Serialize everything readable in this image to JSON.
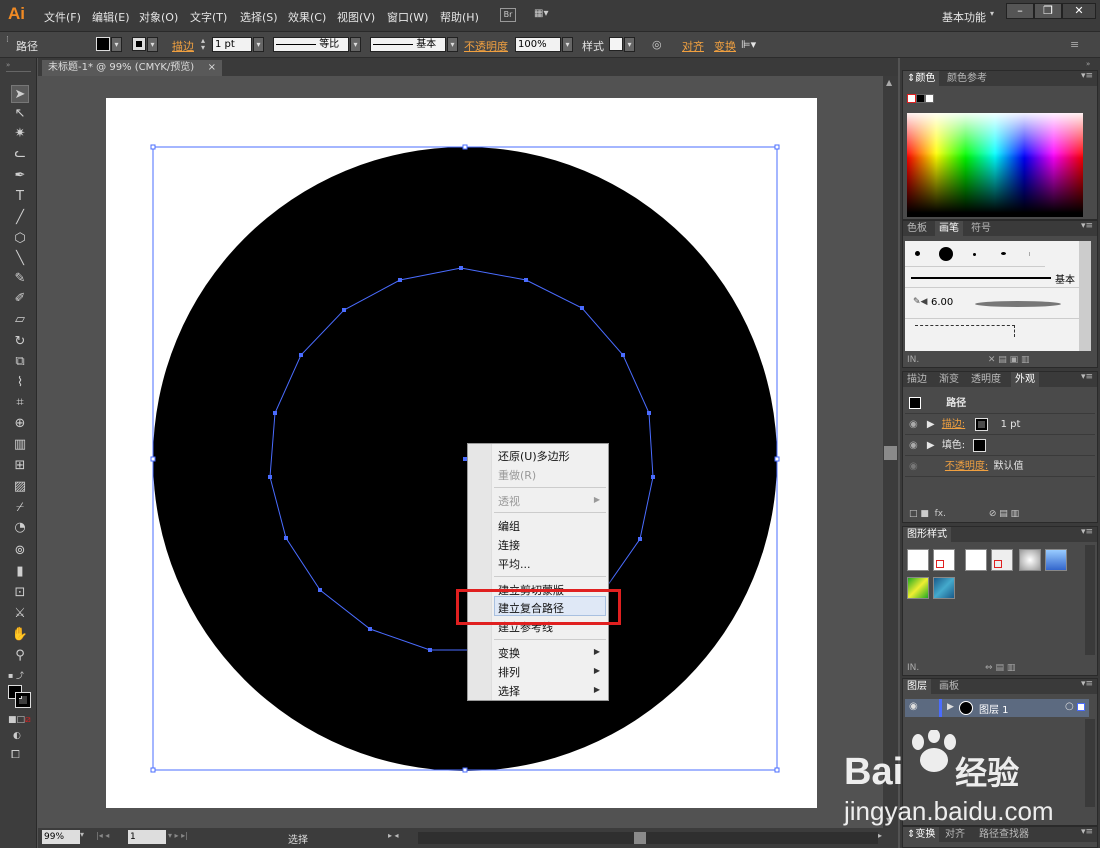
{
  "app": {
    "logo": "Ai",
    "workspace": "基本功能"
  },
  "menu": [
    "文件(F)",
    "编辑(E)",
    "对象(O)",
    "文字(T)",
    "选择(S)",
    "效果(C)",
    "视图(V)",
    "窗口(W)",
    "帮助(H)"
  ],
  "menu_extra": {
    "br": "Br"
  },
  "window_buttons": {
    "minimize": "–",
    "restore": "❐",
    "close": "✕"
  },
  "control": {
    "object_type": "路径",
    "stroke_label": "描边",
    "stroke_weight": "1 pt",
    "profile": "等比",
    "brush": "基本",
    "opacity_label": "不透明度",
    "opacity": "100%",
    "style_label": "样式",
    "align": "对齐",
    "transform": "变换"
  },
  "document": {
    "tab_title": "未标题-1* @ 99% (CMYK/预览)",
    "tab_close": "×"
  },
  "status": {
    "zoom": "99%",
    "page": "1",
    "mode": "选择"
  },
  "context_menu": {
    "items": [
      {
        "label": "还原(U)多边形",
        "enabled": true,
        "submenu": false
      },
      {
        "label": "重做(R)",
        "enabled": false,
        "submenu": false
      },
      {
        "label": "透视",
        "enabled": false,
        "submenu": true
      },
      {
        "label": "编组",
        "enabled": true,
        "submenu": false
      },
      {
        "label": "连接",
        "enabled": true,
        "submenu": false
      },
      {
        "label": "平均...",
        "enabled": true,
        "submenu": false
      },
      {
        "label": "建立剪切蒙版",
        "enabled": true,
        "submenu": false
      },
      {
        "label": "建立复合路径",
        "enabled": true,
        "submenu": false,
        "highlighted": true
      },
      {
        "label": "建立参考线",
        "enabled": true,
        "submenu": false
      },
      {
        "label": "变换",
        "enabled": true,
        "submenu": true
      },
      {
        "label": "排列",
        "enabled": true,
        "submenu": true
      },
      {
        "label": "选择",
        "enabled": true,
        "submenu": true
      }
    ]
  },
  "panels": {
    "color": {
      "tabs": [
        "颜色",
        "颜色参考"
      ]
    },
    "brushes": {
      "tabs": [
        "色板",
        "画笔",
        "符号"
      ],
      "basic": "基本",
      "size": "6.00"
    },
    "appearance": {
      "tabs": [
        "描边",
        "渐变",
        "透明度",
        "外观"
      ],
      "title": "路径",
      "stroke_label": "描边:",
      "stroke_value": "1 pt",
      "fill_label": "填色:",
      "opacity_label": "不透明度:",
      "opacity_value": "默认值"
    },
    "graphic_styles": {
      "tabs": [
        "图形样式"
      ]
    },
    "layers": {
      "tabs": [
        "图层",
        "画板"
      ],
      "layer_name": "图层 1"
    },
    "transform": {
      "tabs": [
        "变换",
        "对齐",
        "路径查找器"
      ]
    }
  },
  "watermark": {
    "brand": "Bai",
    "brand2": "经验",
    "url": "jingyan.baidu.com"
  },
  "colors": {
    "accent": "#f08a24",
    "selection": "#4a6cff",
    "highlight_box": "#e02020"
  }
}
